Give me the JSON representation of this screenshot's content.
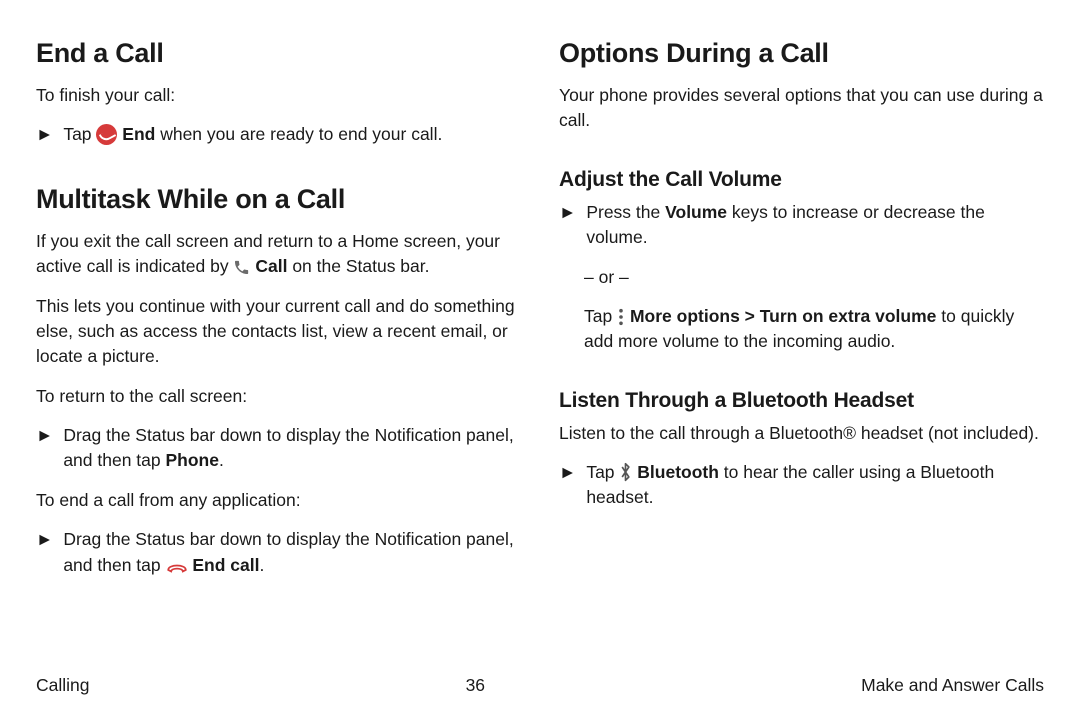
{
  "left": {
    "h_end": "End a Call",
    "end_intro": "To finish your call:",
    "end_bullet_pre": "Tap ",
    "end_bullet_bold": "End",
    "end_bullet_post": " when you are ready to end your call.",
    "h_multi": "Multitask While on a Call",
    "multi_p1_a": "If you exit the call screen and return to a Home screen, your active call is indicated by ",
    "multi_p1_bold": "Call",
    "multi_p1_b": " on the Status bar.",
    "multi_p2": "This lets you continue with your current call and do something else, such as access the contacts list, view a recent email, or locate a picture.",
    "return_label": "To return to the call screen:",
    "return_bullet_a": "Drag the Status bar down to display the Notification panel, and then tap ",
    "return_bullet_bold": "Phone",
    "return_bullet_b": ".",
    "endany_label": "To end a call from any application:",
    "endany_bullet_a": "Drag the Status bar down to display the Notification panel, and then tap ",
    "endany_bullet_bold": "End call",
    "endany_bullet_b": "."
  },
  "right": {
    "h_options": "Options During a Call",
    "options_p": "Your phone provides several options that you can use during a call.",
    "h_volume": "Adjust the Call Volume",
    "vol_bullet_a": "Press the ",
    "vol_bullet_bold": "Volume",
    "vol_bullet_b": " keys to increase or decrease the volume.",
    "or_text": "– or –",
    "vol_more_a": "Tap ",
    "vol_more_bold": "More options > Turn on extra volume",
    "vol_more_b": " to quickly add more volume to the incoming audio.",
    "h_bt": "Listen Through a Bluetooth Headset",
    "bt_p": "Listen to the call through a Bluetooth® headset (not included).",
    "bt_bullet_a": "Tap ",
    "bt_bullet_bold": "Bluetooth",
    "bt_bullet_b": " to hear the caller using a Bluetooth headset."
  },
  "footer": {
    "left": "Calling",
    "center": "36",
    "right": "Make and Answer Calls"
  },
  "marker": "►"
}
